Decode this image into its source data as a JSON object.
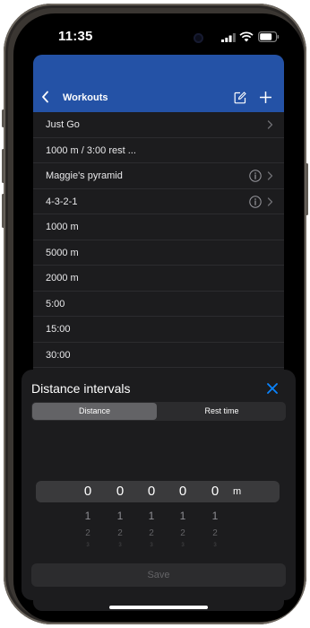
{
  "status": {
    "time": "11:35"
  },
  "header": {
    "back_icon": "chevron-left-icon",
    "title": "Workouts",
    "edit_icon": "compose-icon",
    "add_icon": "plus-icon"
  },
  "workouts": [
    {
      "label": "Just Go",
      "chevron": true,
      "info": false
    },
    {
      "label": "1000 m / 3:00 rest ...",
      "chevron": false,
      "info": false
    },
    {
      "label": "Maggie's pyramid",
      "chevron": true,
      "info": true
    },
    {
      "label": "4-3-2-1",
      "chevron": true,
      "info": true
    },
    {
      "label": "1000 m",
      "chevron": false,
      "info": false
    },
    {
      "label": "5000 m",
      "chevron": false,
      "info": false
    },
    {
      "label": "2000 m",
      "chevron": false,
      "info": false
    },
    {
      "label": "5:00",
      "chevron": false,
      "info": false
    },
    {
      "label": "15:00",
      "chevron": false,
      "info": false
    },
    {
      "label": "30:00",
      "chevron": false,
      "info": false
    }
  ],
  "sheet": {
    "title": "Distance intervals",
    "close_icon": "close-icon",
    "tabs": [
      "Distance",
      "Rest time"
    ],
    "active_tab": "Distance",
    "picker": {
      "digits": [
        "0",
        "0",
        "0",
        "0",
        "0"
      ],
      "below_1": [
        "1",
        "1",
        "1",
        "1",
        "1"
      ],
      "below_2": [
        "2",
        "2",
        "2",
        "2",
        "2"
      ],
      "below_3": [
        "3",
        "3",
        "3",
        "3",
        "3"
      ],
      "unit": "m"
    },
    "save_label": "Save"
  },
  "colors": {
    "header": "#2452a6",
    "accent": "#0a84ff",
    "sheet_bg": "#1c1c1e"
  }
}
